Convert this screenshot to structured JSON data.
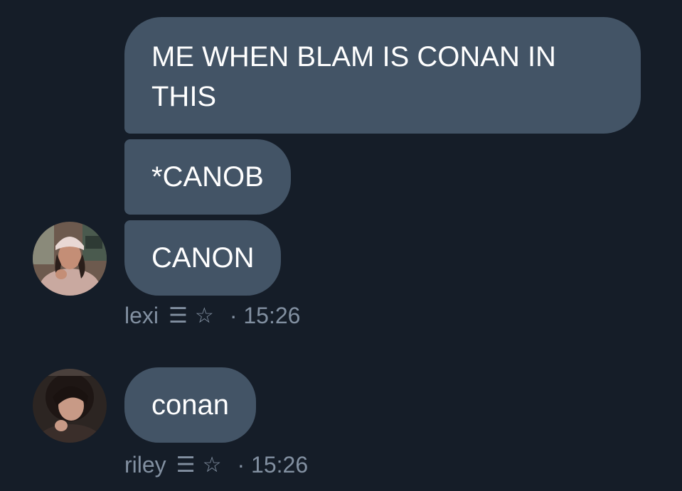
{
  "messages": [
    {
      "sender": "lexi",
      "badge": "☰",
      "star": "☆",
      "time": "· 15:26",
      "bubbles": [
        {
          "lines": [
            "ME WHEN BLAM IS CONAN IN",
            "THIS"
          ]
        },
        {
          "lines": [
            "*CANOB"
          ]
        },
        {
          "lines": [
            "CANON"
          ]
        }
      ]
    },
    {
      "sender": "riley",
      "badge": "☰",
      "star": "☆",
      "time": "· 15:26",
      "bubbles": [
        {
          "lines": [
            "conan"
          ]
        }
      ]
    }
  ],
  "colors": {
    "background": "#151d28",
    "bubble": "#435466",
    "meta_text": "#8290a1"
  }
}
